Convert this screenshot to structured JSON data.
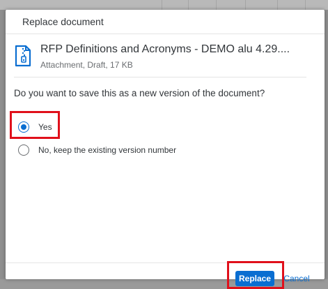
{
  "dialog": {
    "title": "Replace document"
  },
  "file": {
    "icon": "zip-document-icon",
    "name": "RFP Definitions and Acronyms - DEMO alu 4.29....",
    "meta": "Attachment, Draft, 17 KB"
  },
  "question": "Do you want to save this as a new version of the document?",
  "options": [
    {
      "label": "Yes",
      "selected": true
    },
    {
      "label": "No, keep the existing version number",
      "selected": false
    }
  ],
  "footer": {
    "replace_label": "Replace",
    "cancel_label": "Cancel"
  },
  "colors": {
    "accent": "#0a6ed1",
    "highlight": "#e0101b",
    "text": "#32363a"
  }
}
